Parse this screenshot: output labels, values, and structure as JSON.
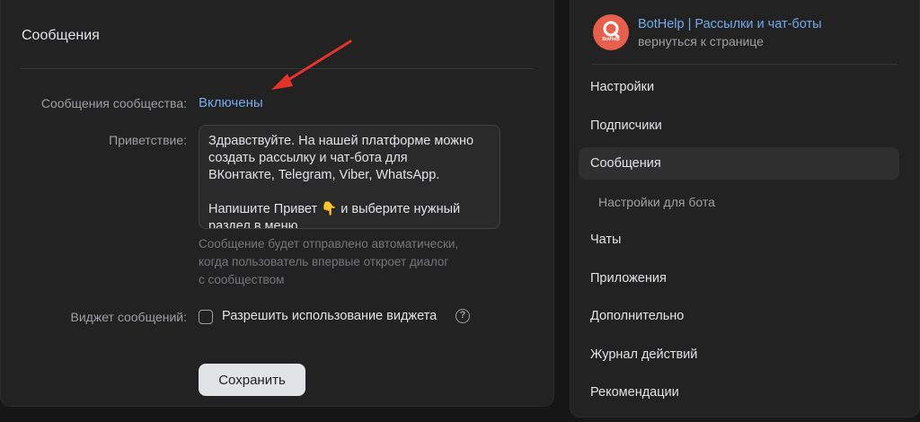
{
  "main": {
    "title": "Сообщения",
    "community_messages": {
      "label": "Сообщения сообщества:",
      "value": "Включены"
    },
    "greeting": {
      "label": "Приветствие:",
      "line1": "Здравствуйте. На нашей платформе можно",
      "line2": "создать рассылку и чат-бота для",
      "line3": "ВКонтакте, Telegram, Viber, WhatsApp.",
      "line4": "Напишите Привет 👇 и выберите нужный",
      "line5": "раздел в меню"
    },
    "hint": {
      "line1": "Сообщение будет отправлено автоматически,",
      "line2": "когда пользователь впервые откроет диалог",
      "line3": "с сообществом"
    },
    "widget": {
      "label": "Виджет сообщений:",
      "checkbox_label": "Разрешить использование виджета",
      "checked": false,
      "help_glyph": "?"
    },
    "save_label": "Сохранить"
  },
  "sidebar": {
    "app_name": "BotHelp | Рассылки и чат-боты",
    "back_link": "вернуться к странице",
    "logo_text": "BotHelp",
    "logo_color": "#e8604c",
    "items": [
      {
        "label": "Настройки"
      },
      {
        "label": "Подписчики"
      },
      {
        "label": "Сообщения"
      },
      {
        "label": "Настройки для бота"
      },
      {
        "label": "Чаты"
      },
      {
        "label": "Приложения"
      },
      {
        "label": "Дополнительно"
      },
      {
        "label": "Журнал действий"
      },
      {
        "label": "Рекомендации"
      }
    ],
    "active_item": "Сообщения"
  },
  "colors": {
    "accent_link": "#71aaeb",
    "annotation_arrow": "#e5332a",
    "background": "#161616",
    "panel": "#222222"
  }
}
